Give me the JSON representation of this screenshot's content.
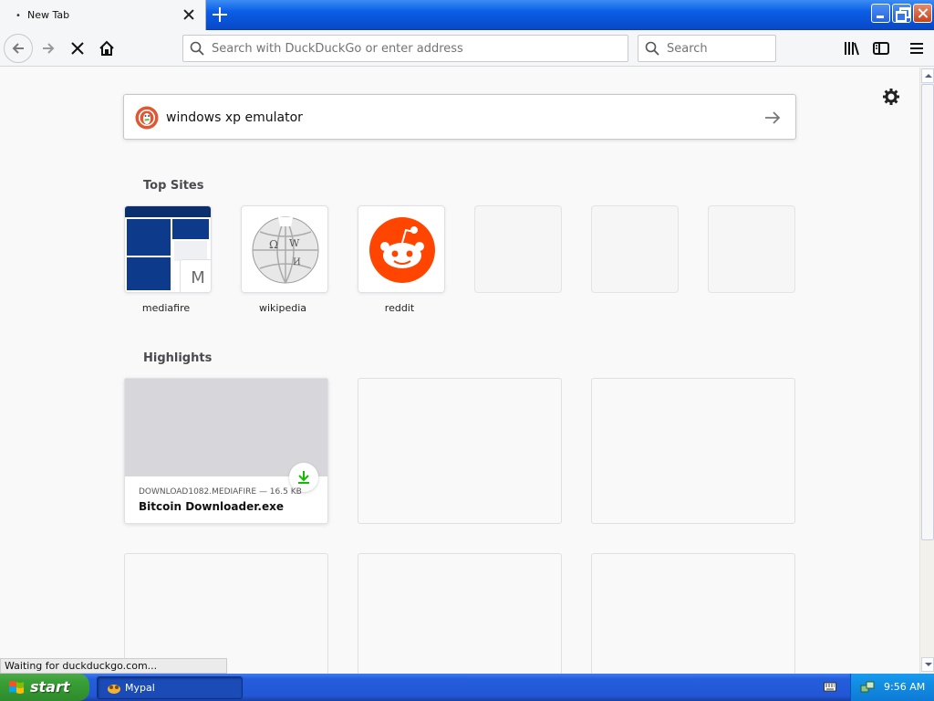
{
  "browser": {
    "tab": {
      "title": "New Tab",
      "dot": "•"
    },
    "address_placeholder": "Search with DuckDuckGo or enter address",
    "search_placeholder": "Search"
  },
  "newtab": {
    "search_query": "windows xp emulator",
    "top_sites_heading": "Top Sites",
    "top_sites": [
      {
        "label": "mediafire",
        "badge": "M"
      },
      {
        "label": "wikipedia"
      },
      {
        "label": "reddit"
      }
    ],
    "highlights_heading": "Highlights",
    "highlight": {
      "source": "DOWNLOAD1082.MEDIAFIRE — 16.5 KB",
      "title": "Bitcoin Downloader.exe"
    }
  },
  "status": "Waiting for duckduckgo.com...",
  "taskbar": {
    "start_label": "start",
    "task_label": "Mypal",
    "clock": "9:56 AM"
  },
  "colors": {
    "reddit": "#ff4500",
    "download_green": "#12bc00",
    "xp_blue": "#245edb",
    "start_green": "#38a035"
  },
  "icons": [
    "back-arrow-icon",
    "forward-arrow-icon",
    "stop-icon",
    "home-icon",
    "search-icon",
    "library-icon",
    "sidebar-icon",
    "hamburger-menu-icon",
    "gear-icon",
    "duckduckgo-logo",
    "arrow-right-icon",
    "download-icon",
    "windows-flag-icon",
    "keyboard-icon",
    "network-icon"
  ]
}
